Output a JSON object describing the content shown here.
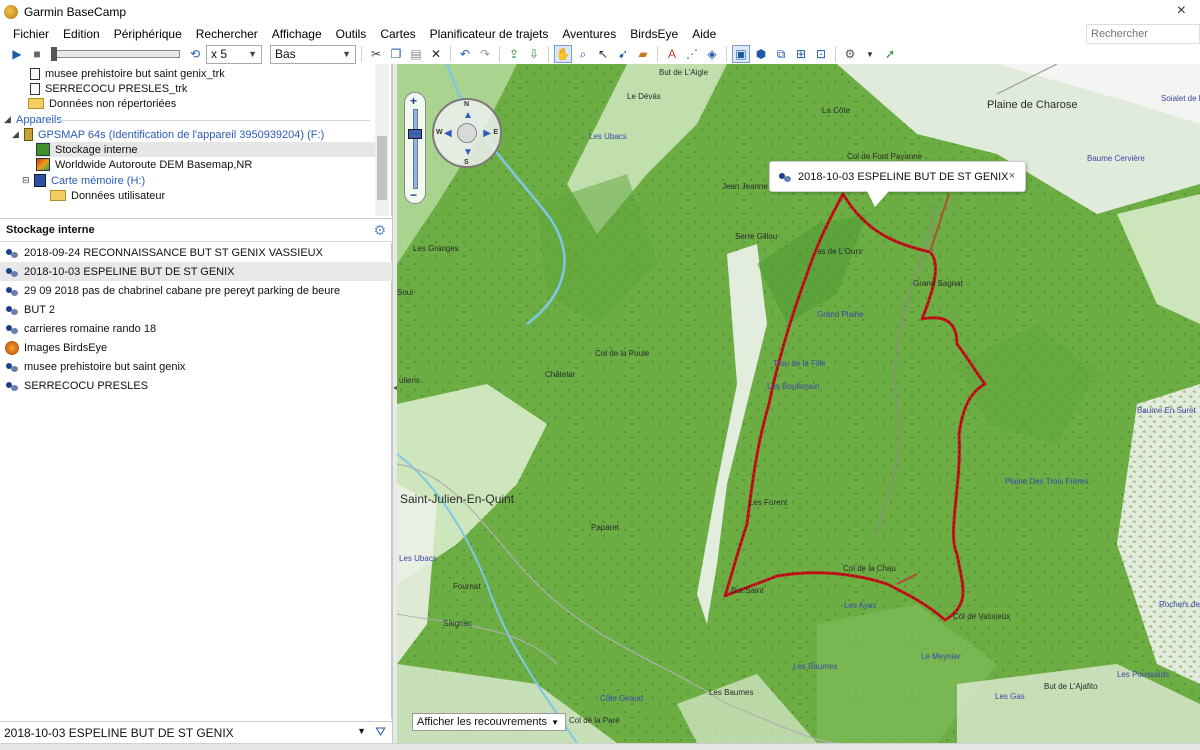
{
  "app": {
    "title": "Garmin BaseCamp",
    "close_glyph": "×"
  },
  "menu": [
    "Fichier",
    "Edition",
    "Périphérique",
    "Rechercher",
    "Affichage",
    "Outils",
    "Cartes",
    "Planificateur de trajets",
    "Aventures",
    "BirdsEye",
    "Aide"
  ],
  "search": {
    "placeholder": "Rechercher"
  },
  "toolbar": {
    "speed": "x 5",
    "elevation_mode": "Bas",
    "icons": [
      "play-icon",
      "stop-icon",
      "loop-icon",
      "cut-icon",
      "copy-icon",
      "paste-icon",
      "delete-icon",
      "undo-icon",
      "redo-icon",
      "upload-icon",
      "download-icon",
      "hand-icon",
      "zoom-icon",
      "select-icon",
      "route-icon",
      "measure-icon",
      "waypoint-icon",
      "track-icon",
      "area-icon",
      "view-2d-icon",
      "view-3d-icon",
      "fit-icon",
      "tools-icon",
      "send-icon"
    ]
  },
  "library_tree": {
    "rows": [
      {
        "label": "musee prehistoire  but saint genix_trk",
        "icon": "file-icon"
      },
      {
        "label": "SERRECOCU PRESLES_trk",
        "icon": "file-icon"
      },
      {
        "label": "Données non répertoriées",
        "icon": "folder-icon"
      }
    ],
    "devices_section": "Appareils",
    "device": "GPSMAP 64s (Identification de l'appareil 3950939204) (F:)",
    "device_children": [
      {
        "label": "Stockage interne",
        "icon": "storage-icon",
        "selected": true
      },
      {
        "label": "Worldwide Autoroute DEM Basemap,NR",
        "icon": "map-icon"
      }
    ],
    "memory_card": "Carte mémoire (H:)",
    "user_data": "Données utilisateur"
  },
  "list_panel": {
    "header": "Stockage interne",
    "items": [
      {
        "label": "2018-09-24 RECONNAISSANCE BUT ST GENIX  VASSIEUX",
        "icon": "track-icon",
        "selected": false
      },
      {
        "label": "2018-10-03  ESPELINE BUT DE ST GENIX",
        "icon": "track-icon",
        "selected": true
      },
      {
        "label": "29 09 2018 pas de chabrinel  cabane pre pereyt  parking de beure",
        "icon": "track-icon",
        "selected": false
      },
      {
        "label": "BUT 2",
        "icon": "track-icon",
        "selected": false
      },
      {
        "label": "carrieres romaine rando 18",
        "icon": "track-icon",
        "selected": false
      },
      {
        "label": "Images BirdsEye",
        "icon": "birdseye-icon",
        "selected": false
      },
      {
        "label": "musee prehistoire  but saint genix",
        "icon": "track-icon",
        "selected": false
      },
      {
        "label": "SERRECOCU PRESLES",
        "icon": "track-icon",
        "selected": false
      }
    ],
    "footer_selected": "2018-10-03  ESPELINE BUT DE ST GENIX"
  },
  "map": {
    "popup_title": "2018-10-03  ESPELINE BUT DE ST GENIX",
    "popup_close": "×",
    "overlay_select": "Afficher les recouvrements",
    "labels": {
      "but_aigle": "But de L'Aigle",
      "le_devas": "Le Dévás",
      "la_cote": "La Côte",
      "plaine_charose": "Plaine de Charose",
      "soialet": "Soialet de la R",
      "les_ubacs_top": "Les Ubacs",
      "col_payanne": "Col de Font Payanne",
      "baume_cerviere": "Baume Cervière",
      "jean_jeanne": "Jean Jeanne",
      "serre_gillou": "Serre Gillou",
      "les_granges": "Les Granges",
      "lours": "as de L'Ours",
      "grand_sagnat": "Grand Sagnat",
      "grand_plaine": "Grand Plaine",
      "col_poule": "Col de la Poule",
      "chatelar": "Châtelar",
      "trou_fille": "Trou de la Fille",
      "boullanain": "Les Boullanain",
      "juliens": "uliens",
      "baume_suret": "Baume En Suret",
      "plaine_freres": "Plaine Des Trois Frères",
      "st_julien": "Saint-Julien-En-Quint",
      "forent": "Les Forent",
      "paparet": "Paparet",
      "les_ubacs_low": "Les Ubacs",
      "col_chau": "Col de la Chau",
      "but_saint": "But Saint",
      "fournat": "Fournat",
      "les_ayas": "Les Ayas",
      "col_vassieux": "Col de Vassieux",
      "sagnac": "Saignac",
      "rochers": "Rochers de",
      "le_meynier": "Le Meynier",
      "les_baumes": "Les Baumes",
      "les_baumes2": "Les Baumes",
      "but_ajafito": "But de L'Ajafito",
      "les_poussaids": "Les Poussaids",
      "les_gas": "Les Gas",
      "cote_giraud": "Côte Giraud",
      "col_pare": "Col de la Pare",
      "soul": "Soul"
    },
    "colors": {
      "track": "#c8151b",
      "terrain": "#6dae45",
      "popup_bg": "#ffffff"
    },
    "compass": {
      "n": "N",
      "s": "S",
      "e": "E",
      "w": "W"
    },
    "zoom": {
      "plus": "+",
      "minus": "−"
    }
  }
}
